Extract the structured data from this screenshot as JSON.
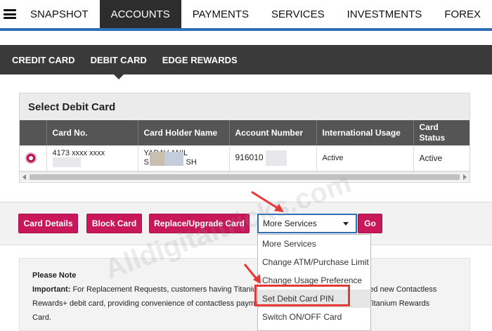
{
  "topnav": {
    "items": [
      "SNAPSHOT",
      "ACCOUNTS",
      "PAYMENTS",
      "SERVICES",
      "INVESTMENTS",
      "FOREX"
    ],
    "active": "ACCOUNTS"
  },
  "subnav": {
    "items": [
      "CREDIT CARD",
      "DEBIT CARD",
      "EDGE REWARDS"
    ],
    "active": "DEBIT CARD"
  },
  "panel": {
    "title": "Select Debit Card",
    "columns": [
      "Card No.",
      "Card Holder Name",
      "Account Number",
      "International Usage",
      "Card Status"
    ],
    "row": {
      "card_no": "4173 xxxx xxxx",
      "holder_line1": "YADAV ANIL",
      "holder_line2": "S",
      "holder_line2_end": "SH",
      "account": "916010",
      "intl": "Active",
      "status": "Active"
    }
  },
  "actions": {
    "card_details": "Card Details",
    "block_card": "Block Card",
    "replace_card": "Replace/Upgrade Card",
    "select_value": "More Services",
    "go": "Go"
  },
  "dropdown": {
    "options": [
      "More Services",
      "Change ATM/Purchase Limit",
      "Change Usage Preference",
      "Set Debit Card PIN",
      "Switch ON/OFF Card"
    ],
    "highlighted": "Set Debit Card PIN"
  },
  "note": {
    "heading": "Please Note",
    "important_label": "Important:",
    "line1a": "For Replacement Requests, customers having Titanium",
    "line1b": "ered new Contactless",
    "line2a": "Rewards+ debit card, providing convenience of contactless payme",
    "line2b": "s of Titanium Rewards",
    "line3": "Card."
  },
  "watermark": "Alldigitaltricks.com",
  "colors": {
    "accent": "#c8185a",
    "nav_dark": "#2d2d2d",
    "brand_blue": "#2e6fb6",
    "annotation_red": "#e53935"
  }
}
